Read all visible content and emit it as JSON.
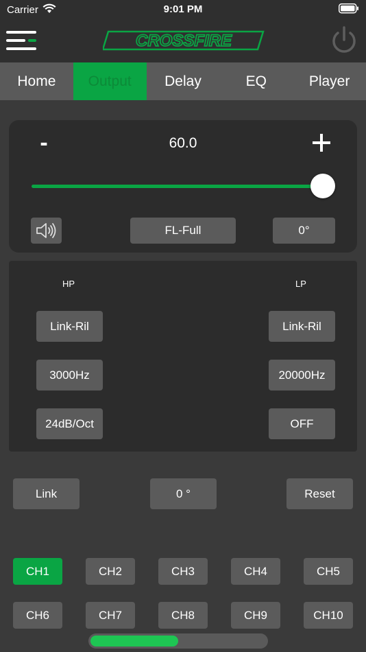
{
  "status_bar": {
    "carrier": "Carrier",
    "time": "9:01 PM"
  },
  "header": {
    "logo_text": "CROSSFIRE"
  },
  "tabs": [
    {
      "label": "Home",
      "active": false
    },
    {
      "label": "Output",
      "active": true
    },
    {
      "label": "Delay",
      "active": false
    },
    {
      "label": "EQ",
      "active": false
    },
    {
      "label": "Player",
      "active": false
    }
  ],
  "volume": {
    "minus_label": "-",
    "value": "60.0",
    "slider_level": 1.0,
    "channel_name": "FL-Full",
    "phase": "0°"
  },
  "filters": {
    "hp": {
      "label": "HP",
      "type": "Link-Ril",
      "frequency": "3000Hz",
      "slope": "24dB/Oct"
    },
    "lp": {
      "label": "LP",
      "type": "Link-Ril",
      "frequency": "20000Hz",
      "slope": "OFF"
    }
  },
  "actions": {
    "link": "Link",
    "phase": "0 °",
    "reset": "Reset"
  },
  "channels": [
    {
      "label": "CH1",
      "active": true
    },
    {
      "label": "CH2",
      "active": false
    },
    {
      "label": "CH3",
      "active": false
    },
    {
      "label": "CH4",
      "active": false
    },
    {
      "label": "CH5",
      "active": false
    },
    {
      "label": "CH6",
      "active": false
    },
    {
      "label": "CH7",
      "active": false
    },
    {
      "label": "CH8",
      "active": false
    },
    {
      "label": "CH9",
      "active": false
    },
    {
      "label": "CH10",
      "active": false
    }
  ],
  "page_progress": 0.5,
  "colors": {
    "accent": "#0aa544",
    "background": "#3a3a3a",
    "panel": "#2c2c2c",
    "button": "#5b5b5b"
  }
}
